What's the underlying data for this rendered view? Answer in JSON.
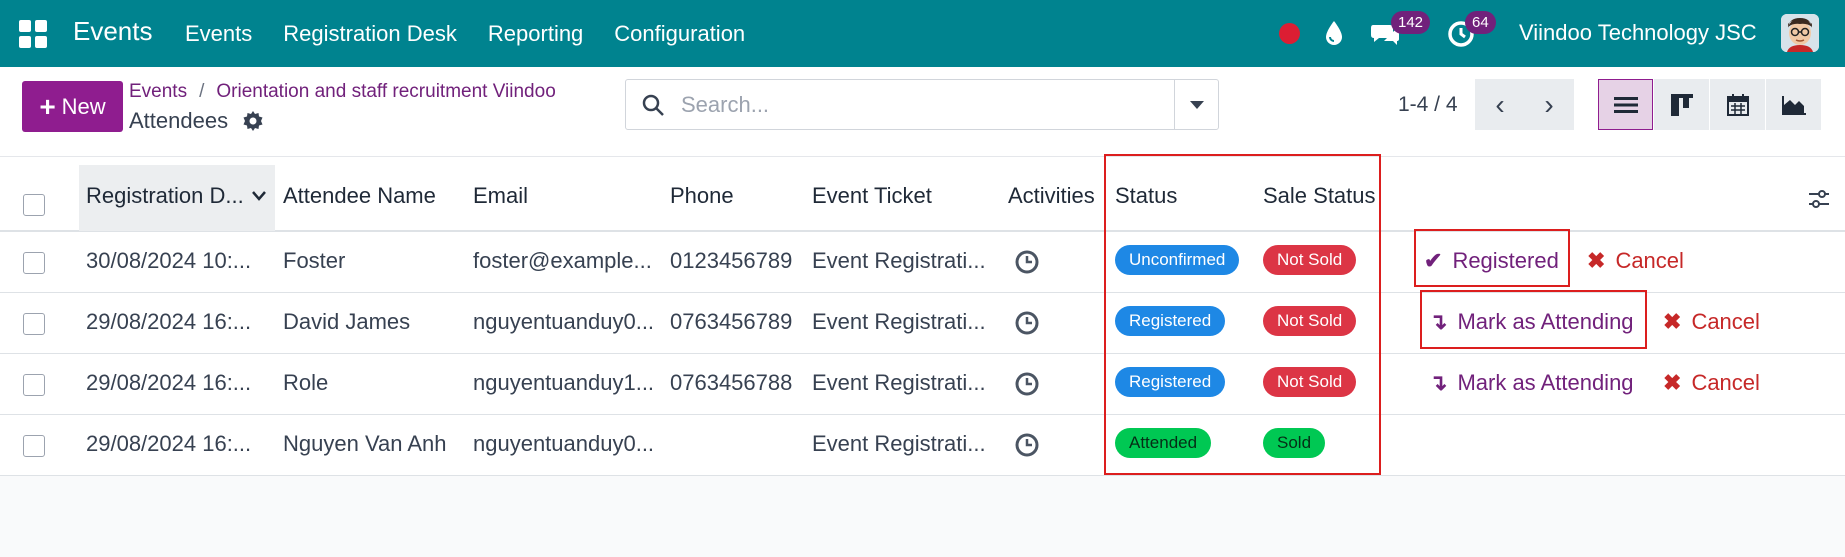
{
  "navbar": {
    "brand": "Events",
    "menu": [
      "Events",
      "Registration Desk",
      "Reporting",
      "Configuration"
    ],
    "chat_count": "142",
    "activity_count": "64",
    "company": "Viindoo Technology JSC"
  },
  "control": {
    "new_label": "New",
    "breadcrumb": [
      "Events",
      "Orientation and staff recruitment Viindoo"
    ],
    "breadcrumb_sep": "/",
    "title": "Attendees",
    "search_placeholder": "Search...",
    "pager": "1-4 / 4"
  },
  "table": {
    "columns": [
      "Registration D...",
      "Attendee Name",
      "Email",
      "Phone",
      "Event Ticket",
      "Activities",
      "Status",
      "Sale Status"
    ],
    "rows": [
      {
        "date": "30/08/2024 10:...",
        "name": "Foster",
        "email": "foster@example...",
        "phone": "0123456789",
        "ticket": "Event Registrati...",
        "status": "Unconfirmed",
        "sale": "Not Sold",
        "action1": "Registered",
        "action2": "Cancel"
      },
      {
        "date": "29/08/2024 16:...",
        "name": "David James",
        "email": "nguyentuanduy0...",
        "phone": "0763456789",
        "ticket": "Event Registrati...",
        "status": "Registered",
        "sale": "Not Sold",
        "action1": "Mark as Attending",
        "action2": "Cancel"
      },
      {
        "date": "29/08/2024 16:...",
        "name": "Role",
        "email": "nguyentuanduy1...",
        "phone": "0763456788",
        "ticket": "Event Registrati...",
        "status": "Registered",
        "sale": "Not Sold",
        "action1": "Mark as Attending",
        "action2": "Cancel"
      },
      {
        "date": "29/08/2024 16:...",
        "name": "Nguyen Van Anh",
        "email": "nguyentuanduy0...",
        "phone": "",
        "ticket": "Event Registrati...",
        "status": "Attended",
        "sale": "Sold"
      }
    ]
  },
  "colors": {
    "navbar": "#00838f",
    "primary": "#8f1d8f",
    "highlight": "#dc1e1e"
  }
}
